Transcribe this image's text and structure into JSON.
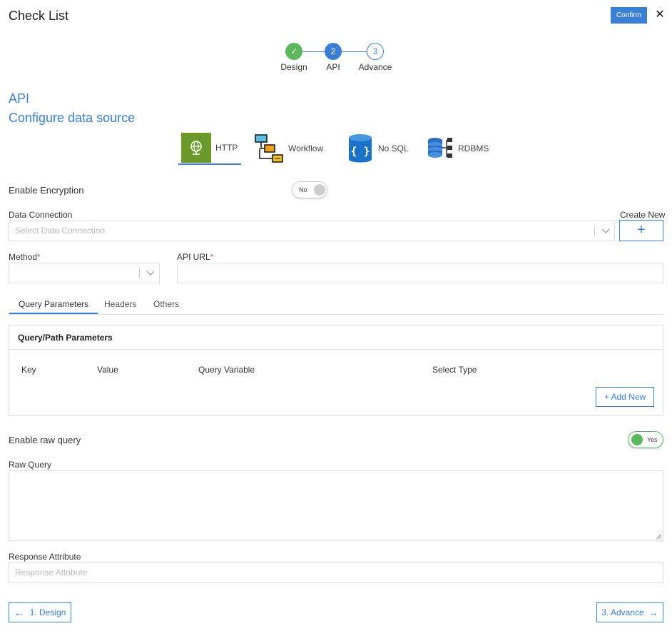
{
  "header": {
    "title": "Check List",
    "confirm_label": "Confirm",
    "close_glyph": "✕"
  },
  "stepper": {
    "steps": [
      {
        "number": "✓",
        "label": "Design",
        "state": "done"
      },
      {
        "number": "2",
        "label": "API",
        "state": "active"
      },
      {
        "number": "3",
        "label": "Advance",
        "state": "pending"
      }
    ]
  },
  "section": {
    "title": "API",
    "subtitle": "Configure data source"
  },
  "source_types": [
    {
      "label": "HTTP",
      "icon": "globe-icon",
      "active": true
    },
    {
      "label": "Workflow",
      "icon": "workflow-icon",
      "active": false
    },
    {
      "label": "No SQL",
      "icon": "nosql-icon",
      "active": false
    },
    {
      "label": "RDBMS",
      "icon": "rdbms-icon",
      "active": false
    }
  ],
  "encryption": {
    "label": "Enable Encryption",
    "toggle_text": "No"
  },
  "data_connection": {
    "label": "Data Connection",
    "placeholder": "Select Data Connection",
    "create_new_label": "Create New",
    "plus_glyph": "+"
  },
  "method": {
    "label": "Method",
    "required_mark": "*",
    "value": ""
  },
  "api_url": {
    "label": "API URL",
    "required_mark": "*",
    "value": ""
  },
  "tabs": [
    {
      "label": "Query Parameters",
      "active": true
    },
    {
      "label": "Headers",
      "active": false
    },
    {
      "label": "Others",
      "active": false
    }
  ],
  "params_panel": {
    "title": "Query/Path Parameters",
    "columns": [
      "Key",
      "Value",
      "Query Variable",
      "Select Type"
    ],
    "add_new_label": "+ Add New"
  },
  "raw_query": {
    "toggle_label": "Enable raw query",
    "toggle_text": "Yes",
    "field_label": "Raw Query",
    "value": ""
  },
  "response_attribute": {
    "label": "Response Attribute",
    "placeholder": "Response Attribute"
  },
  "footer": {
    "back_label": "1. Design",
    "next_label": "3. Advance",
    "back_arrow": "←",
    "next_arrow": "→"
  },
  "colors": {
    "accent": "#3a7fd5",
    "success": "#5cb85c",
    "http_tile": "#6b9a2a",
    "required": "#d9534f"
  }
}
